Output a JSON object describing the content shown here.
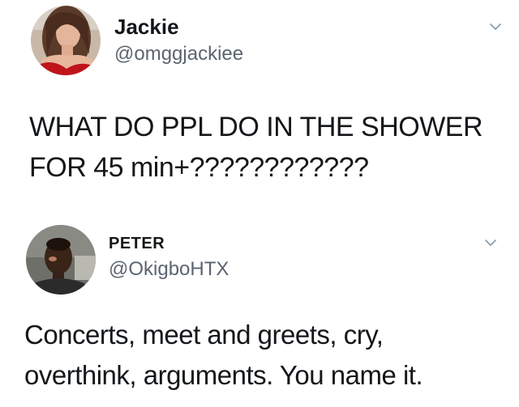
{
  "tweets": [
    {
      "display_name": "Jackie",
      "handle": "@omggjackiee",
      "text_lines": [
        "WHAT DO PPL DO IN THE SHOWER",
        "FOR 45 min+????????????"
      ],
      "menu_icon": "chevron-down-icon"
    },
    {
      "display_name": "PETER",
      "handle": "@OkigboHTX",
      "text_lines": [
        "Concerts, meet and greets, cry,",
        "overthink, arguments. You name it."
      ],
      "menu_icon": "chevron-down-icon"
    }
  ],
  "colors": {
    "text": "#14171a",
    "handle": "#5b6570",
    "caret": "#8899a6",
    "background": "#ffffff"
  }
}
